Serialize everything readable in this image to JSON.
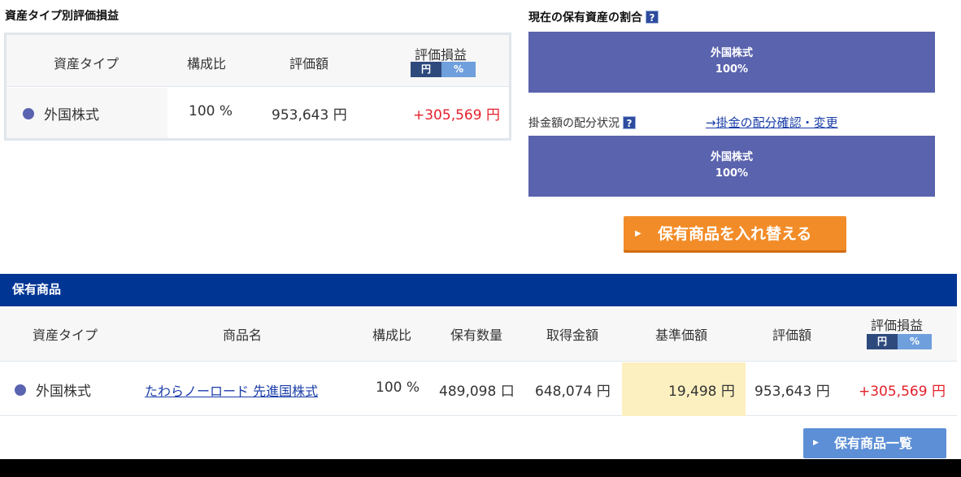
{
  "asset_section": {
    "title": "資産タイプ別評価損益",
    "headers": {
      "asset_type": "資産タイプ",
      "ratio": "構成比",
      "valuation": "評価額",
      "pnl": "評価損益"
    },
    "toggle": {
      "yen": "円",
      "pct": "%"
    },
    "row": {
      "asset_type": "外国株式",
      "ratio": "100 %",
      "valuation": "953,643 円",
      "pnl": "+305,569 円"
    }
  },
  "holdings_ratio": {
    "title": "現在の保有資産の割合",
    "help": "?",
    "bar_label": "外国株式",
    "bar_value": "100%"
  },
  "allocation": {
    "label": "掛金額の配分状況",
    "help": "?",
    "link": "→掛金の配分確認・変更",
    "bar_label": "外国株式",
    "bar_value": "100%"
  },
  "switch_button": {
    "label": "保有商品を入れ替える"
  },
  "holdings": {
    "title": "保有商品",
    "headers": {
      "asset_type": "資産タイプ",
      "product": "商品名",
      "ratio": "構成比",
      "units": "保有数量",
      "cost": "取得金額",
      "base_price": "基準価額",
      "valuation": "評価額",
      "pnl": "評価損益"
    },
    "toggle": {
      "yen": "円",
      "pct": "%"
    },
    "row": {
      "asset_type": "外国株式",
      "product": "たわらノーロード 先進国株式",
      "ratio": "100 %",
      "units": "489,098 口",
      "cost": "648,074 円",
      "base_price": "19,498 円",
      "valuation": "953,643 円",
      "pnl": "+305,569 円"
    }
  },
  "list_button": {
    "label": "保有商品一覧"
  },
  "colors": {
    "navy": "#003594",
    "bar": "#5a63ad",
    "orange": "#f28c28",
    "gain_red": "#e5202c",
    "highlight": "#fdf0c0"
  }
}
